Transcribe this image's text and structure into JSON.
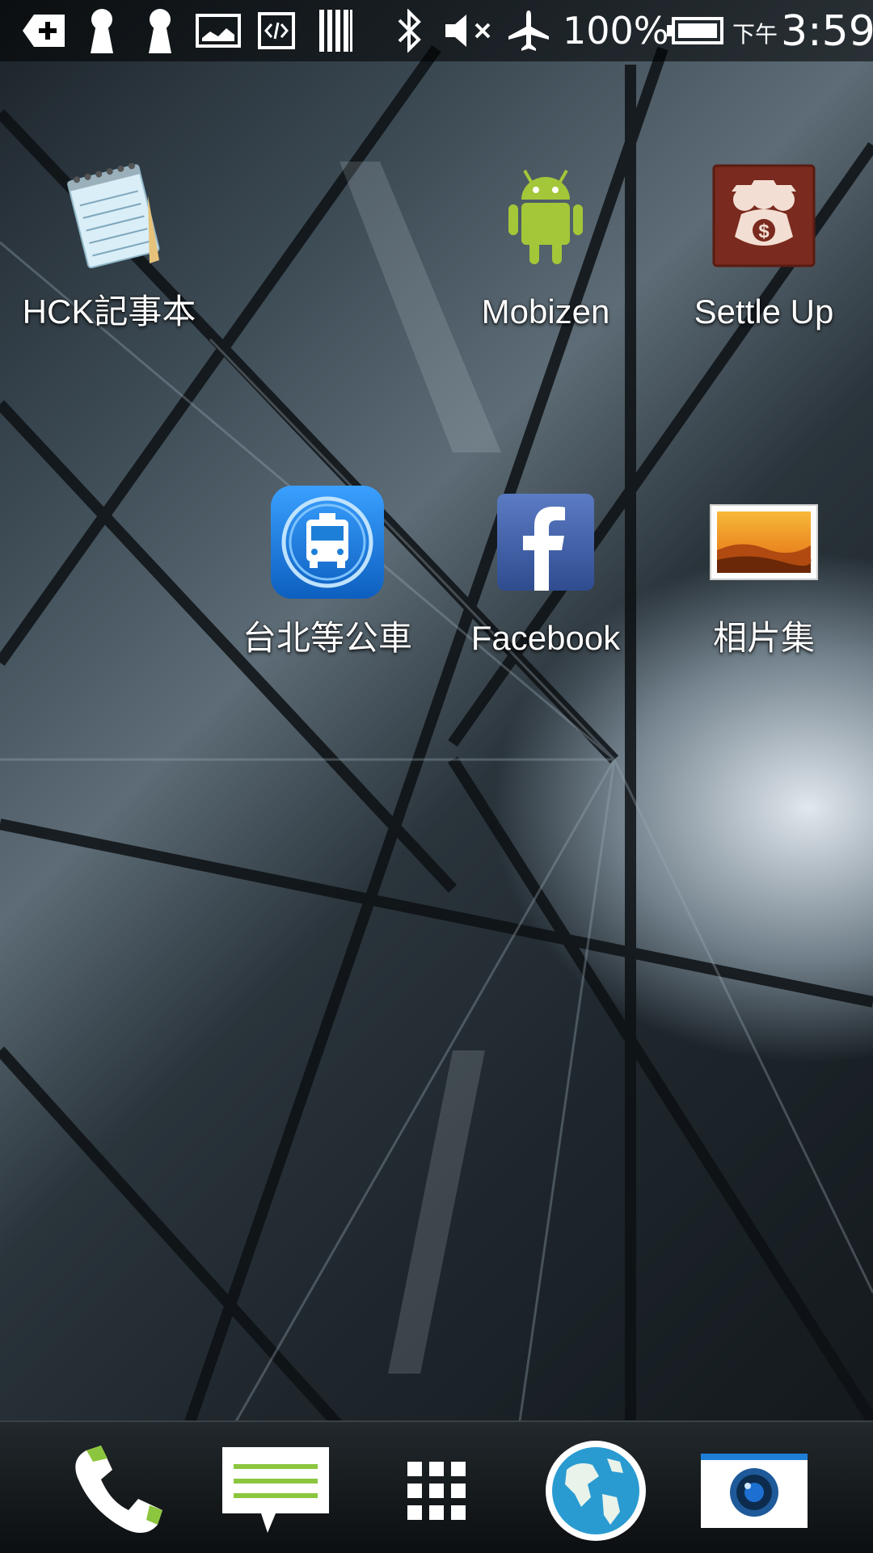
{
  "status_bar": {
    "battery_percent": "100%",
    "clock_prefix": "下午",
    "clock": "3:59",
    "icons": [
      "notification-plus-icon",
      "keyhole-icon",
      "keyhole-icon",
      "screenshot-icon",
      "code-icon",
      "barcode-icon",
      "bluetooth-icon",
      "mute-icon",
      "airplane-mode-icon",
      "battery-icon"
    ]
  },
  "apps": [
    {
      "label": "HCK記事本",
      "icon": "notepad-icon"
    },
    {
      "label": "Mobizen",
      "icon": "android-icon"
    },
    {
      "label": "Settle Up",
      "icon": "money-bag-icon"
    },
    {
      "label": "台北等公車",
      "icon": "bus-icon"
    },
    {
      "label": "Facebook",
      "icon": "facebook-icon"
    },
    {
      "label": "相片集",
      "icon": "photo-gallery-icon"
    }
  ],
  "dock": {
    "items": [
      "phone-icon",
      "messages-icon",
      "app-drawer-icon",
      "browser-globe-icon",
      "camera-icon"
    ]
  },
  "colors": {
    "facebook_blue": "#3b5998",
    "android_green": "#a4c639",
    "settle_up_red": "#7a2a1e",
    "bus_blue": "#1e7fd8"
  }
}
